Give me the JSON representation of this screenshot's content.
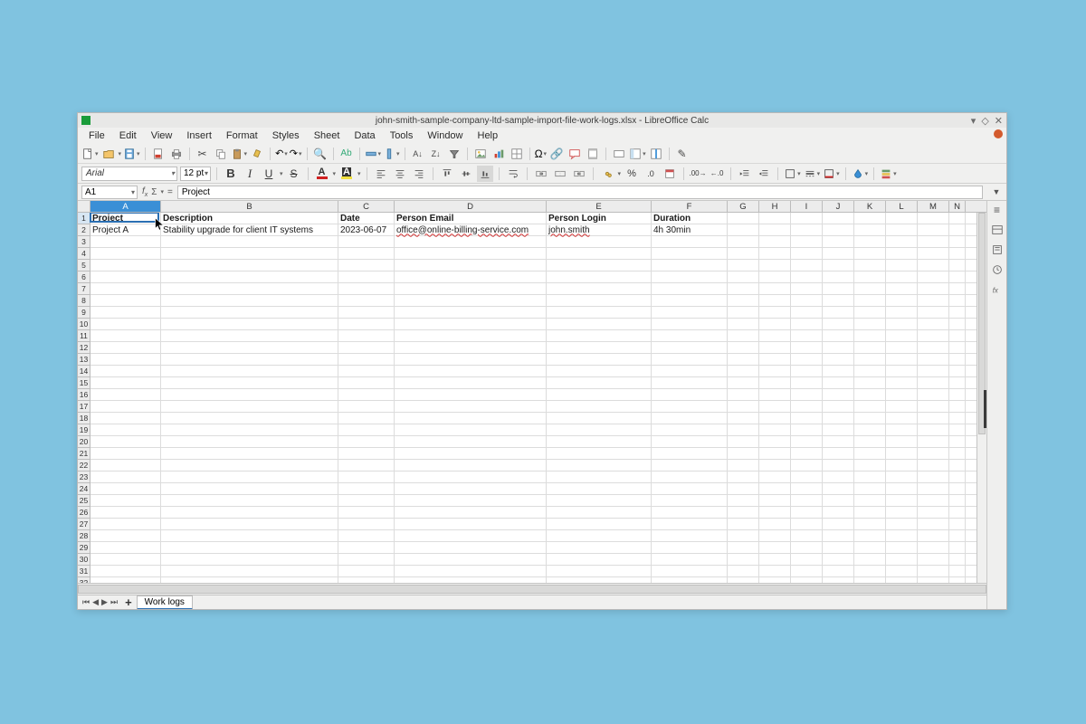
{
  "window": {
    "title": "john-smith-sample-company-ltd-sample-import-file-work-logs.xlsx - LibreOffice Calc"
  },
  "menubar": [
    "File",
    "Edit",
    "View",
    "Insert",
    "Format",
    "Styles",
    "Sheet",
    "Data",
    "Tools",
    "Window",
    "Help"
  ],
  "format_bar": {
    "font_name": "Arial",
    "font_size": "12 pt"
  },
  "formula_bar": {
    "cell_ref": "A1",
    "content": "Project"
  },
  "columns": [
    {
      "letter": "A",
      "width": 78,
      "selected": true
    },
    {
      "letter": "B",
      "width": 196
    },
    {
      "letter": "C",
      "width": 62
    },
    {
      "letter": "D",
      "width": 168
    },
    {
      "letter": "E",
      "width": 116
    },
    {
      "letter": "F",
      "width": 84
    },
    {
      "letter": "G",
      "width": 35
    },
    {
      "letter": "H",
      "width": 35
    },
    {
      "letter": "I",
      "width": 35
    },
    {
      "letter": "J",
      "width": 35
    },
    {
      "letter": "K",
      "width": 35
    },
    {
      "letter": "L",
      "width": 35
    },
    {
      "letter": "M",
      "width": 35
    },
    {
      "letter": "N",
      "width": 18
    }
  ],
  "row_count": 32,
  "headers_row": [
    "Project",
    "Description",
    "Date",
    "Person Email",
    "Person Login",
    "Duration"
  ],
  "data_rows": [
    {
      "cells": [
        "Project A",
        "Stability upgrade for client IT systems",
        "2023-06-07",
        "office@online-billing-service.com",
        "john.smith",
        "4h 30min"
      ],
      "spellcheck_cols": [
        3,
        4
      ]
    }
  ],
  "active_cell": {
    "row": 0,
    "col": 0
  },
  "sheet_tab": "Work logs"
}
